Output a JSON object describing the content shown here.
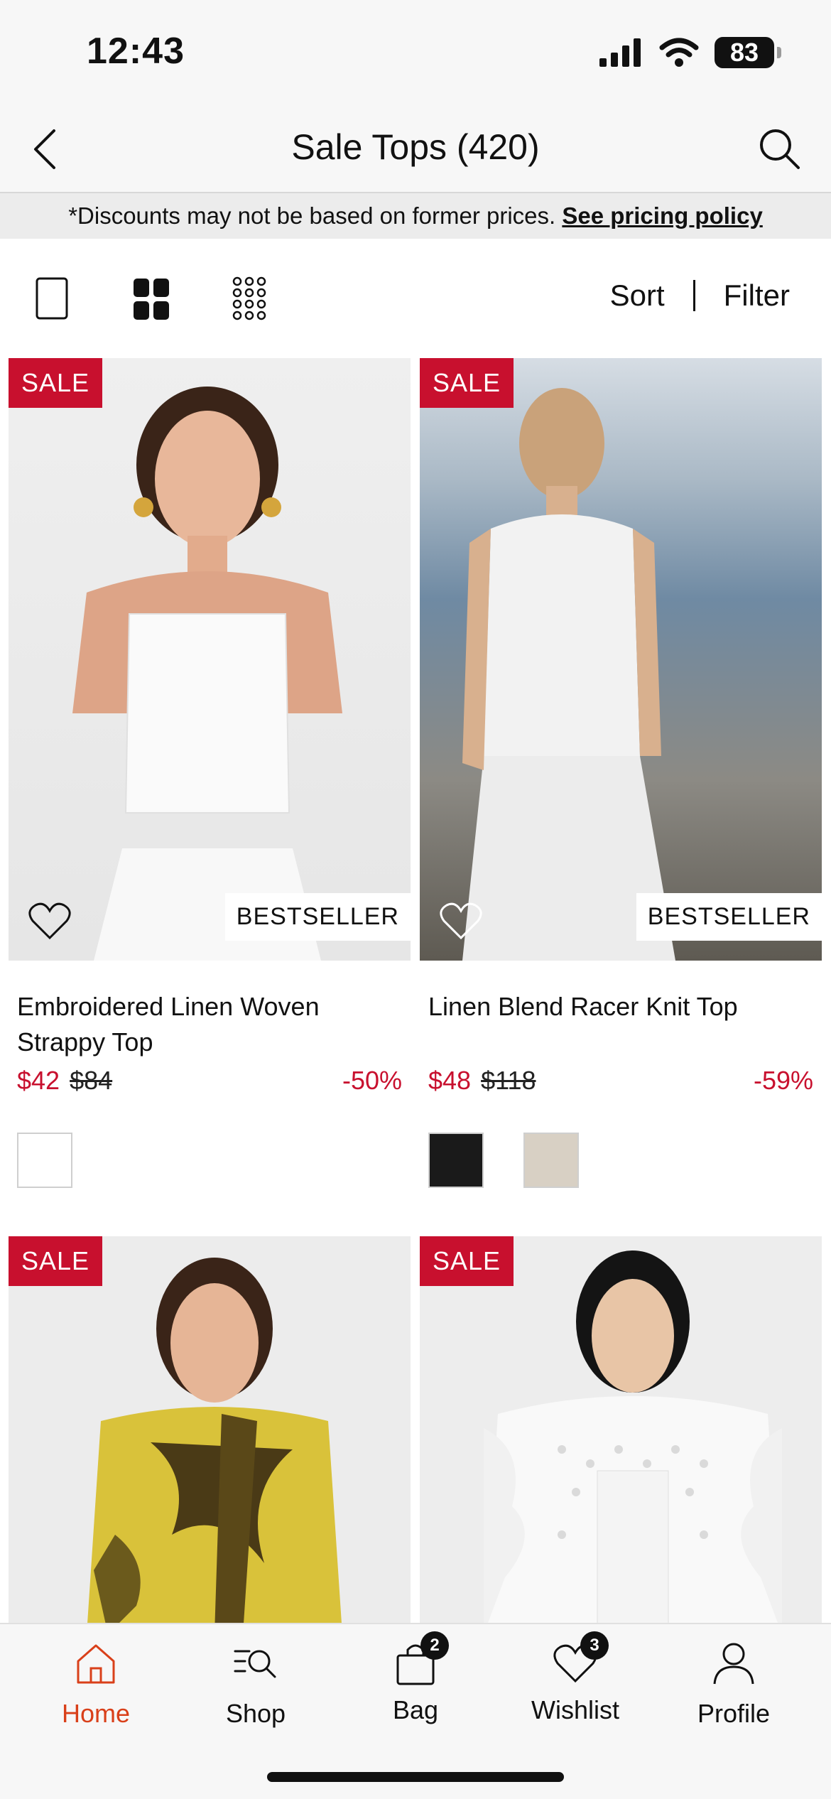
{
  "status_bar": {
    "time": "12:43",
    "battery": "83"
  },
  "header": {
    "title": "Sale Tops (420)"
  },
  "notice": {
    "text": "*Discounts may not be based on former prices.",
    "link": "See pricing policy"
  },
  "toolbar": {
    "sort": "Sort",
    "filter": "Filter"
  },
  "products": [
    {
      "badge": "SALE",
      "tag": "BESTSELLER",
      "name_line1": "Embroidered Linen Woven",
      "name_line2": "Strappy Top",
      "price": "$42",
      "old_price": "$84",
      "discount": "-50%",
      "swatches": [
        "#ffffff"
      ]
    },
    {
      "badge": "SALE",
      "tag": "BESTSELLER",
      "name_line1": "Linen Blend Racer Knit Top",
      "name_line2": "",
      "price": "$48",
      "old_price": "$118",
      "discount": "-59%",
      "swatches": [
        "#1a1a1a",
        "#d8d0c4"
      ]
    },
    {
      "badge": "SALE"
    },
    {
      "badge": "SALE"
    }
  ],
  "tabs": [
    {
      "label": "Home",
      "icon": "home-icon",
      "active": true
    },
    {
      "label": "Shop",
      "icon": "shop-search-icon"
    },
    {
      "label": "Bag",
      "icon": "bag-icon",
      "count": "2"
    },
    {
      "label": "Wishlist",
      "icon": "heart-icon",
      "count": "3"
    },
    {
      "label": "Profile",
      "icon": "profile-icon"
    }
  ],
  "colors": {
    "sale_red": "#c8102e",
    "active_tab": "#d9401a"
  }
}
